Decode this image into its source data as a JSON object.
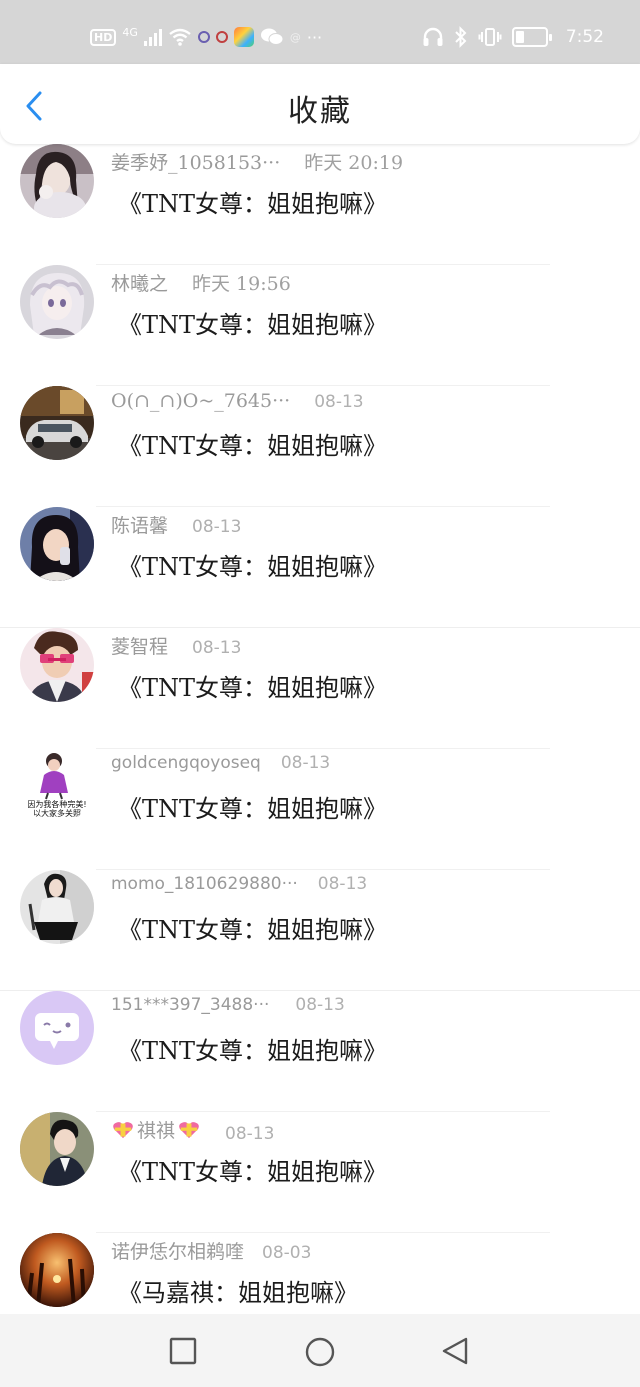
{
  "status_bar": {
    "network": "4G",
    "hd": "HD",
    "more": "···",
    "time": "7:52"
  },
  "header": {
    "title": "收藏",
    "back_icon": "chevron-left-icon"
  },
  "items": [
    {
      "name": "姜季妤_1058153···",
      "time": "昨天 20:19",
      "title": "《TNT女尊：姐姐抱嘛》",
      "avatar": "avatar-girl-photo"
    },
    {
      "name": "林曦之",
      "time": "昨天 19:56",
      "title": "《TNT女尊：姐姐抱嘛》",
      "avatar": "avatar-anime-girl"
    },
    {
      "name": "O(∩_∩)O~_7645···",
      "time": "08-13",
      "title": "《TNT女尊：姐姐抱嘛》",
      "avatar": "avatar-car"
    },
    {
      "name": "陈语馨",
      "time": "08-13",
      "title": "《TNT女尊：姐姐抱嘛》",
      "avatar": "avatar-girl-phone"
    },
    {
      "name": "菱智程",
      "time": "08-13",
      "title": "《TNT女尊：姐姐抱嘛》",
      "avatar": "avatar-boy-glasses"
    },
    {
      "name": "goldcengqoyoseq",
      "time": "08-13",
      "title": "《TNT女尊：姐姐抱嘛》",
      "avatar": "avatar-cartoon-sticker",
      "avatar_text": [
        "因为我各种完美!",
        "以大家多关照"
      ]
    },
    {
      "name": "momo_1810629880···",
      "time": "08-13",
      "title": "《TNT女尊：姐姐抱嘛》",
      "avatar": "avatar-girl-dress"
    },
    {
      "name": "151***397_3488···",
      "time": "08-13",
      "title": "《TNT女尊：姐姐抱嘛》",
      "avatar": "avatar-default-chat"
    },
    {
      "name": "祺祺",
      "time": "08-13",
      "title": "《TNT女尊：姐姐抱嘛》",
      "avatar": "avatar-boy-suit",
      "name_decor": "heart-icon"
    },
    {
      "name": "诺伊恁尔相鹈喹",
      "time": "08-03",
      "title": "《马嘉祺：姐姐抱嘛》",
      "avatar": "avatar-autumn-forest"
    }
  ],
  "colors": {
    "accent": "#2a8ef0",
    "status_bar": "#d6d6d6",
    "meta_text": "#9a9a9a",
    "title_text": "#1c1c1c",
    "default_avatar": "#d9c8f5"
  },
  "navbar": {
    "recent_icon": "square-icon",
    "home_icon": "circle-icon",
    "back_icon": "triangle-back-icon"
  }
}
